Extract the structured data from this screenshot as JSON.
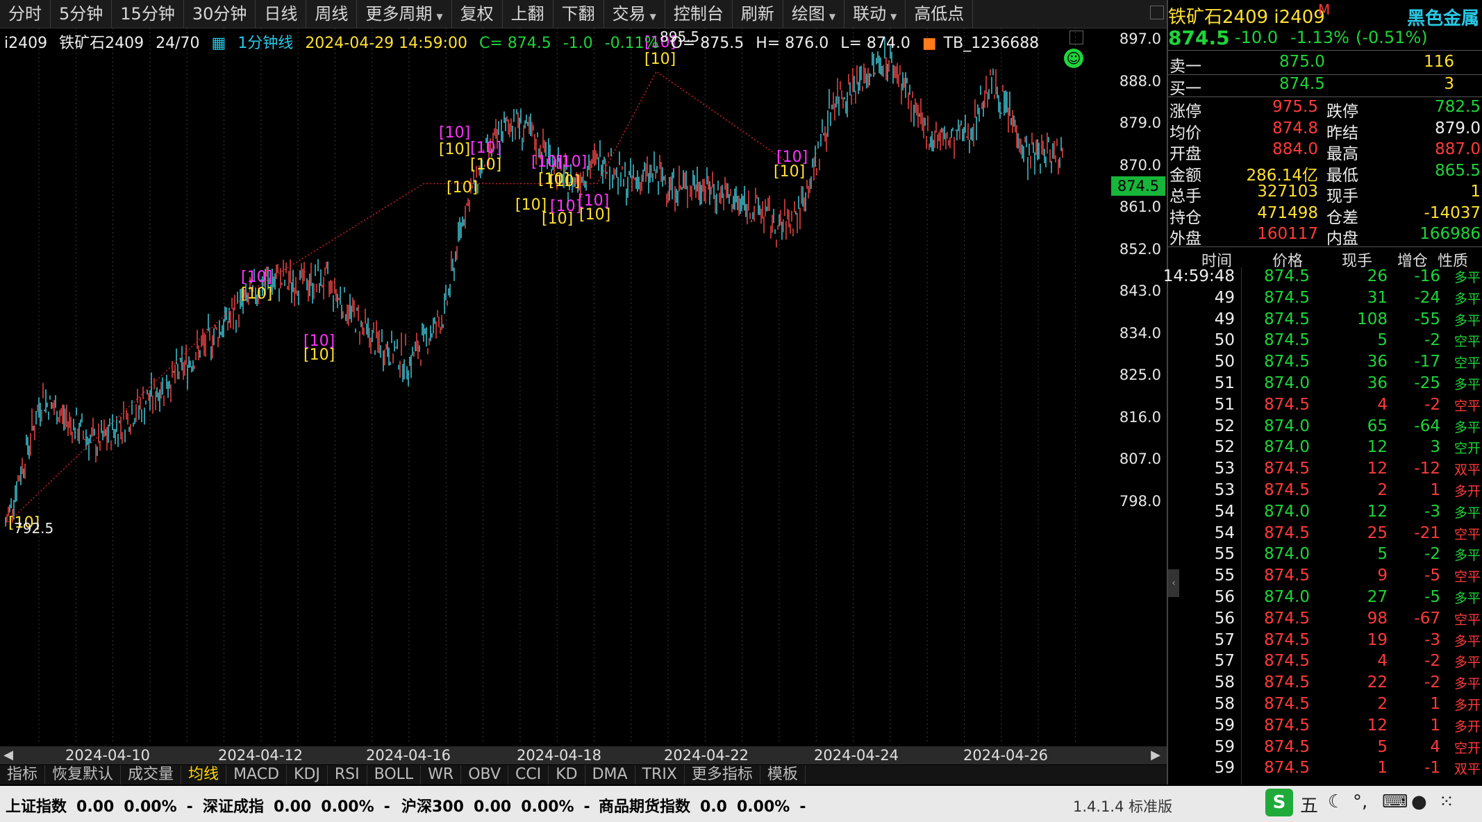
{
  "toolbar": {
    "items": [
      {
        "label": "分时",
        "dropdown": false
      },
      {
        "label": "5分钟",
        "dropdown": false
      },
      {
        "label": "15分钟",
        "dropdown": false
      },
      {
        "label": "30分钟",
        "dropdown": false
      },
      {
        "label": "日线",
        "dropdown": false
      },
      {
        "label": "周线",
        "dropdown": false
      },
      {
        "label": "更多周期",
        "dropdown": true
      },
      {
        "label": "复权",
        "dropdown": false
      },
      {
        "label": "上翻",
        "dropdown": false
      },
      {
        "label": "下翻",
        "dropdown": false
      },
      {
        "label": "交易",
        "dropdown": true
      },
      {
        "label": "控制台",
        "dropdown": false
      },
      {
        "label": "刷新",
        "dropdown": false
      },
      {
        "label": "绘图",
        "dropdown": true
      },
      {
        "label": "联动",
        "dropdown": true
      },
      {
        "label": "高低点",
        "dropdown": false
      }
    ]
  },
  "info": {
    "code": "i2409",
    "name": "铁矿石2409",
    "page": "24/70",
    "period": "1分钟线",
    "datetime": "2024-04-29 14:59:00",
    "close": "C= 874.5",
    "change": "-1.0",
    "pct": "-0.11%",
    "open": "O= 875.5",
    "high": "H= 876.0",
    "low": "L= 874.0",
    "tb_label": "TB_1236688"
  },
  "chart": {
    "y_ticks": [
      "897.0",
      "888.0",
      "879.0",
      "870.0",
      "861.0",
      "852.0",
      "843.0",
      "834.0",
      "825.0",
      "816.0",
      "807.0",
      "798.0"
    ],
    "last_price": "874.5",
    "high_label": "895.5",
    "low_label": "792.5",
    "marker_text": "[10]",
    "x_labels": [
      "2024-04-10",
      "2024-04-12",
      "2024-04-16",
      "2024-04-18",
      "2024-04-22",
      "2024-04-24",
      "2024-04-26"
    ]
  },
  "indicator_tabs": [
    "指标",
    "恢复默认",
    "成交量",
    "均线",
    "MACD",
    "KDJ",
    "RSI",
    "BOLL",
    "WR",
    "OBV",
    "CCI",
    "KD",
    "DMA",
    "TRIX",
    "更多指标",
    "模板"
  ],
  "active_tab": "均线",
  "quote": {
    "title_name": "铁矿石2409 i2409",
    "title_mark": "M",
    "sector": "黑色金属",
    "price": "874.5",
    "change": "-10.0",
    "pct": "-1.13%",
    "pct2": "(-0.51%)",
    "sell1": {
      "label": "卖一",
      "price": "875.0",
      "vol": "116"
    },
    "buy1": {
      "label": "买一",
      "price": "874.5",
      "vol": "3"
    },
    "rows": [
      {
        "l1": "涨停",
        "v1": "975.5",
        "c1": "red",
        "l2": "跌停",
        "v2": "782.5",
        "c2": "green"
      },
      {
        "l1": "均价",
        "v1": "874.8",
        "c1": "red",
        "l2": "昨结",
        "v2": "879.0",
        "c2": "white"
      },
      {
        "l1": "开盘",
        "v1": "884.0",
        "c1": "red",
        "l2": "最高",
        "v2": "887.0",
        "c2": "red"
      },
      {
        "l1": "金额",
        "v1": "286.14亿",
        "c1": "yellow",
        "l2": "最低",
        "v2": "865.5",
        "c2": "green"
      },
      {
        "l1": "总手",
        "v1": "327103",
        "c1": "yellow",
        "l2": "现手",
        "v2": "1",
        "c2": "yellow"
      },
      {
        "l1": "持仓",
        "v1": "471498",
        "c1": "yellow",
        "l2": "仓差",
        "v2": "-14037",
        "c2": "yellow"
      },
      {
        "l1": "外盘",
        "v1": "160117",
        "c1": "red",
        "l2": "内盘",
        "v2": "166986",
        "c2": "green"
      }
    ]
  },
  "ticks": {
    "headers": [
      "时间",
      "价格",
      "现手",
      "增仓",
      "性质"
    ],
    "rows": [
      [
        "14:59:48",
        "874.5",
        "26",
        "-16",
        "多平",
        "green"
      ],
      [
        "49",
        "874.5",
        "31",
        "-24",
        "多平",
        "green"
      ],
      [
        "49",
        "874.5",
        "108",
        "-55",
        "多平",
        "green"
      ],
      [
        "50",
        "874.5",
        "5",
        "-2",
        "空平",
        "green"
      ],
      [
        "50",
        "874.5",
        "36",
        "-17",
        "空平",
        "green"
      ],
      [
        "51",
        "874.0",
        "36",
        "-25",
        "多平",
        "green"
      ],
      [
        "51",
        "874.5",
        "4",
        "-2",
        "空平",
        "red"
      ],
      [
        "52",
        "874.0",
        "65",
        "-64",
        "多平",
        "green"
      ],
      [
        "52",
        "874.0",
        "12",
        "3",
        "空开",
        "green"
      ],
      [
        "53",
        "874.5",
        "12",
        "-12",
        "双平",
        "red"
      ],
      [
        "53",
        "874.5",
        "2",
        "1",
        "多开",
        "red"
      ],
      [
        "54",
        "874.0",
        "12",
        "-3",
        "多平",
        "green"
      ],
      [
        "54",
        "874.5",
        "25",
        "-21",
        "空平",
        "red"
      ],
      [
        "55",
        "874.0",
        "5",
        "-2",
        "多平",
        "green"
      ],
      [
        "55",
        "874.5",
        "9",
        "-5",
        "空平",
        "red"
      ],
      [
        "56",
        "874.0",
        "27",
        "-5",
        "多平",
        "green"
      ],
      [
        "56",
        "874.5",
        "98",
        "-67",
        "空平",
        "red"
      ],
      [
        "57",
        "874.5",
        "19",
        "-3",
        "多平",
        "red"
      ],
      [
        "57",
        "874.5",
        "4",
        "-2",
        "多平",
        "red"
      ],
      [
        "58",
        "874.5",
        "22",
        "-2",
        "多平",
        "red"
      ],
      [
        "58",
        "874.5",
        "2",
        "1",
        "多开",
        "red"
      ],
      [
        "59",
        "874.5",
        "12",
        "1",
        "多开",
        "red"
      ],
      [
        "59",
        "874.5",
        "5",
        "4",
        "空开",
        "red"
      ],
      [
        "59",
        "874.5",
        "1",
        "-1",
        "双平",
        "red"
      ]
    ]
  },
  "status": {
    "indices": [
      {
        "name": "上证指数",
        "val": "0.00",
        "pct": "0.00%",
        "dash": "-"
      },
      {
        "name": "深证成指",
        "val": "0.00",
        "pct": "0.00%",
        "dash": "-"
      },
      {
        "name": "沪深300",
        "val": "0.00",
        "pct": "0.00%",
        "dash": "-"
      },
      {
        "name": "商品期货指数",
        "val": "0.0",
        "pct": "0.00%",
        "dash": "-"
      }
    ],
    "version": "1.4.1.4 标准版",
    "ime": "五"
  }
}
